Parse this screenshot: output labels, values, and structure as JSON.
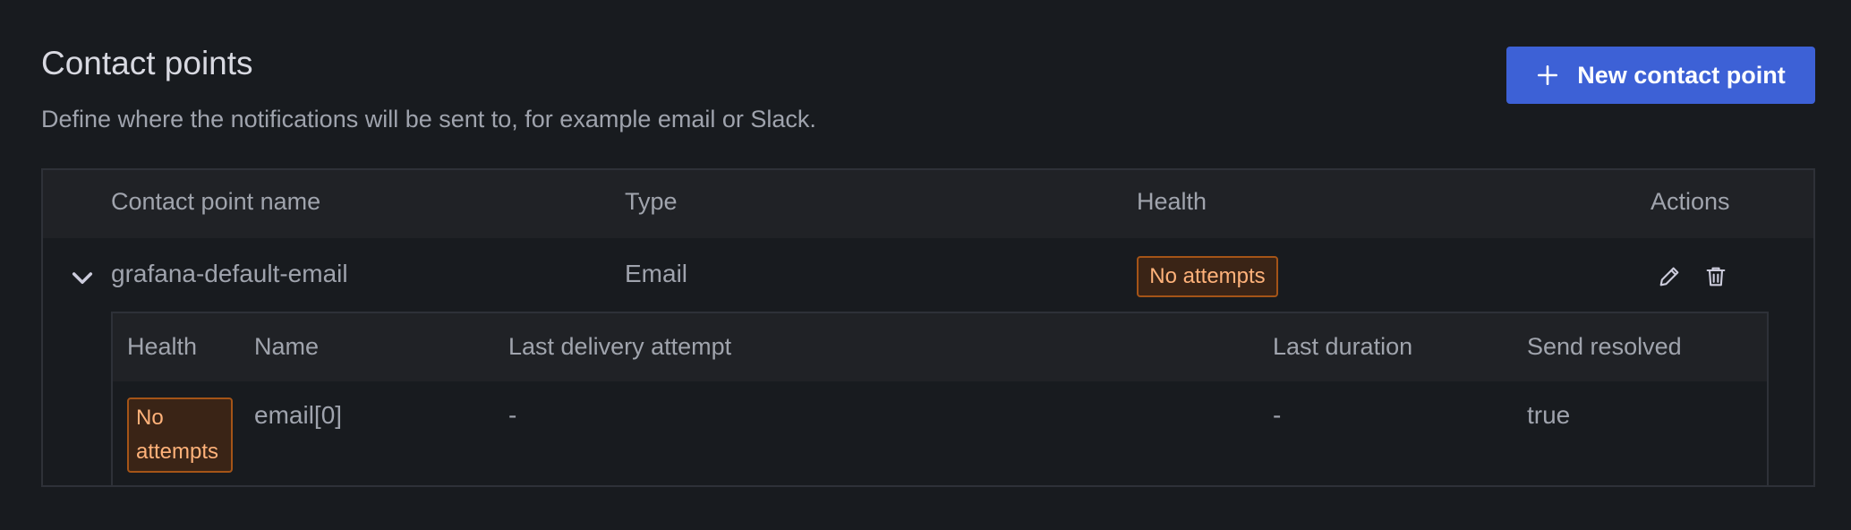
{
  "header": {
    "title": "Contact points",
    "subtitle": "Define where the notifications will be sent to, for example email or Slack.",
    "new_button_label": "New contact point"
  },
  "table": {
    "columns": [
      "Contact point name",
      "Type",
      "Health",
      "Actions"
    ],
    "rows": [
      {
        "name": "grafana-default-email",
        "type": "Email",
        "health": "No attempts",
        "expanded": true,
        "actions": [
          "edit-icon",
          "trash-icon"
        ]
      }
    ]
  },
  "subtable": {
    "columns": [
      "Health",
      "Name",
      "Last delivery attempt",
      "Last duration",
      "Send resolved"
    ],
    "rows": [
      {
        "health": "No attempts",
        "name": "email[0]",
        "last_delivery_attempt": "-",
        "last_duration": "-",
        "send_resolved": "true"
      }
    ]
  },
  "colors": {
    "background": "#181b1f",
    "primary_button": "#3d61d6",
    "warning_badge_bg": "#3a2416",
    "warning_badge_border": "#a45417",
    "warning_badge_text": "#ffb27a"
  }
}
